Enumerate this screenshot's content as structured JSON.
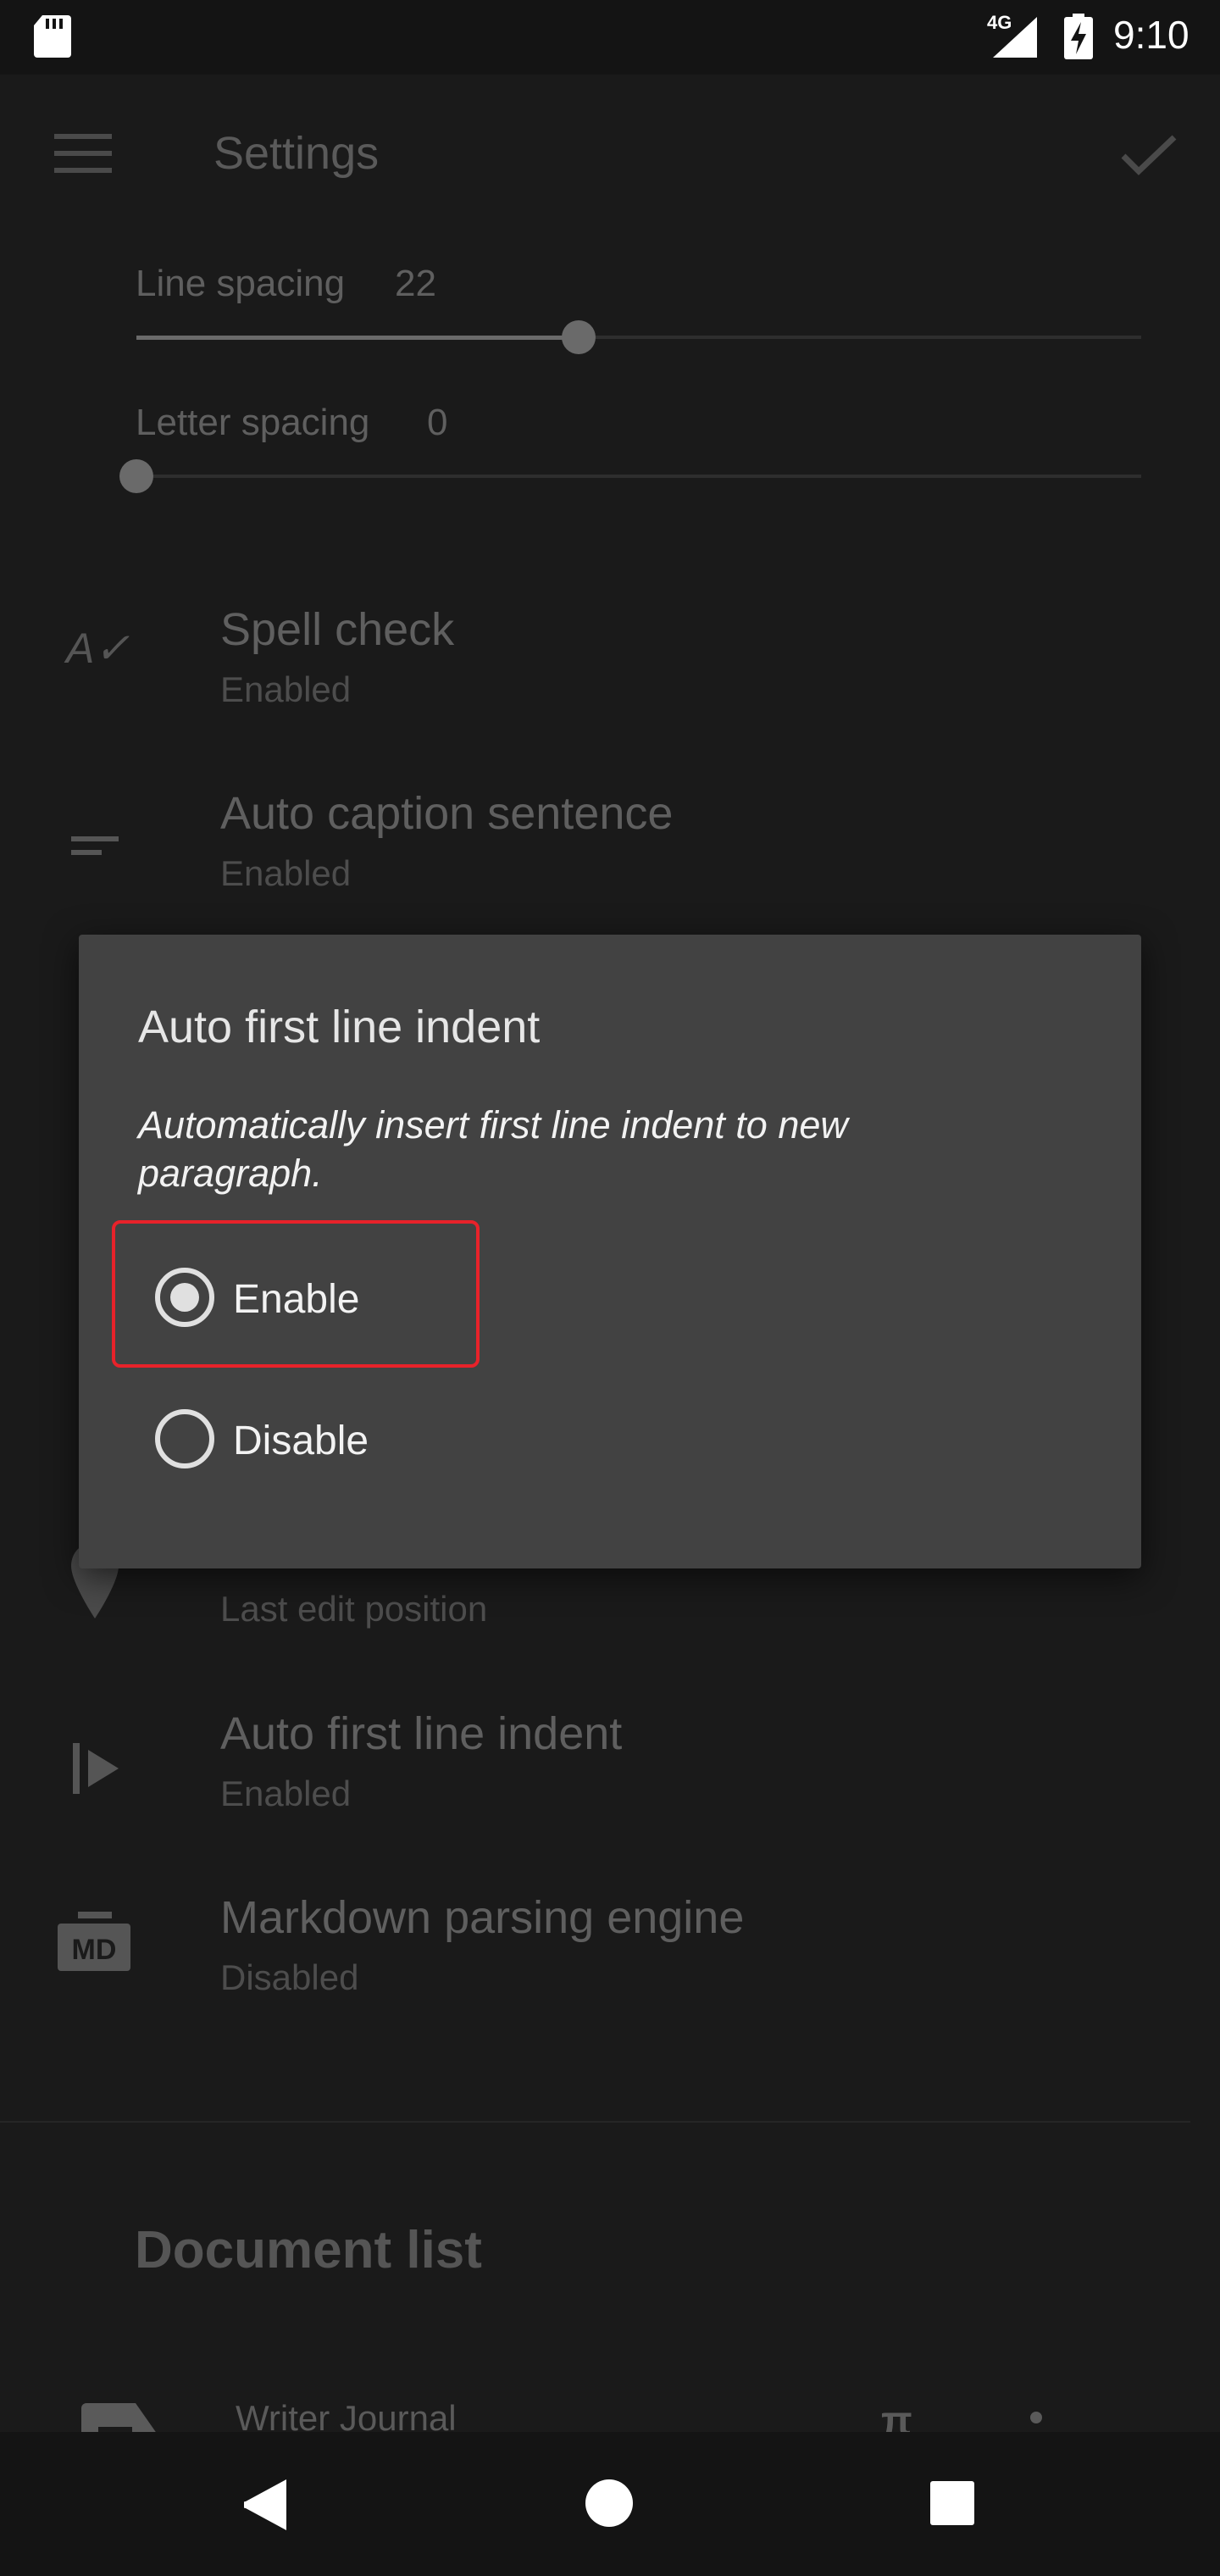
{
  "status_bar": {
    "time": "9:10",
    "network": "4G"
  },
  "app_bar": {
    "title": "Settings"
  },
  "sliders": [
    {
      "label": "Line spacing",
      "value": "22",
      "fraction": 0.44
    },
    {
      "label": "Letter spacing",
      "value": "0",
      "fraction": 0.0
    }
  ],
  "settings": {
    "spell_check": {
      "title": "Spell check",
      "subtitle": "Enabled"
    },
    "auto_caption": {
      "title": "Auto caption sentence",
      "subtitle": "Enabled"
    },
    "cursor_position": {
      "subtitle": "Last edit position"
    },
    "auto_indent": {
      "title": "Auto first line indent",
      "subtitle": "Enabled"
    },
    "markdown": {
      "title": "Markdown parsing engine",
      "subtitle": "Disabled"
    }
  },
  "document_list": {
    "header": "Document list",
    "first_item": "Writer Journal"
  },
  "dialog": {
    "title": "Auto first line indent",
    "description": "Automatically insert first line indent to new paragraph.",
    "options": [
      {
        "label": "Enable",
        "selected": true
      },
      {
        "label": "Disable",
        "selected": false
      }
    ]
  },
  "colors": {
    "dialog_bg": "#424242",
    "highlight": "#e8222a"
  }
}
